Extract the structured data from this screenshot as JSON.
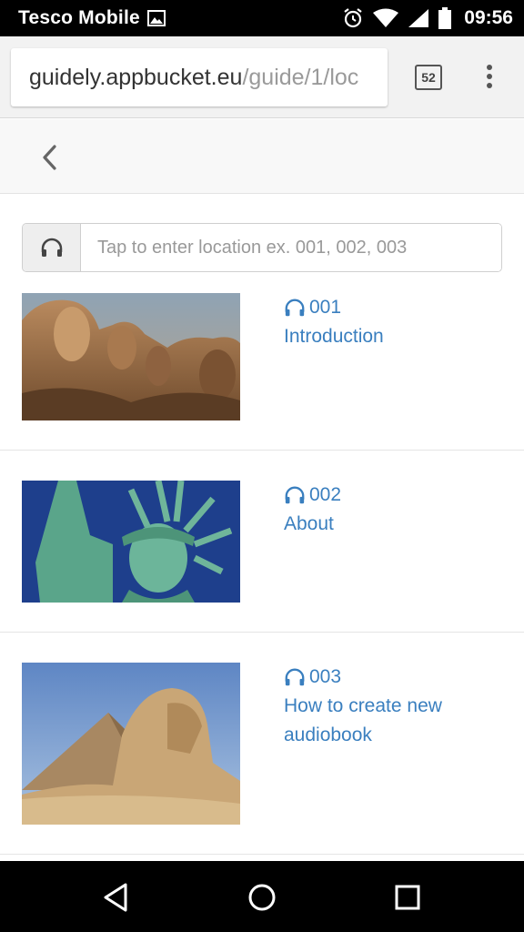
{
  "status_bar": {
    "carrier": "Tesco Mobile",
    "time": "09:56"
  },
  "browser": {
    "url_host": "guidely.appbucket.eu",
    "url_path": "/guide/1/loc",
    "tab_count": "52"
  },
  "search": {
    "placeholder": "Tap to enter location ex. 001, 002, 003"
  },
  "items": [
    {
      "number": "001",
      "title": "Introduction",
      "image": "mount-rushmore"
    },
    {
      "number": "002",
      "title": "About",
      "image": "statue-of-liberty"
    },
    {
      "number": "003",
      "title": "How to create new audiobook",
      "image": "sphinx-pyramid"
    }
  ],
  "colors": {
    "link": "#3a7fbf",
    "status_bar": "#000000",
    "toolbar": "#f2f2f2"
  }
}
